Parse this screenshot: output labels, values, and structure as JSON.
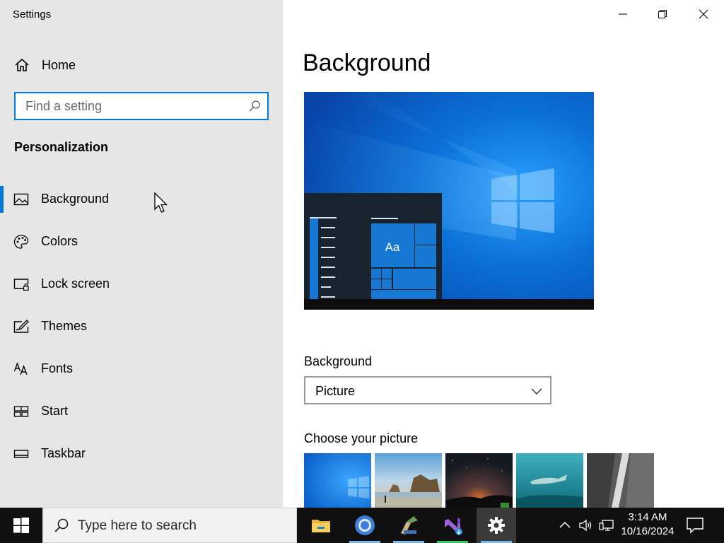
{
  "window": {
    "title": "Settings",
    "minimize_icon": "minimize-icon",
    "restore_icon": "restore-icon",
    "close_icon": "close-icon"
  },
  "sidebar": {
    "home_label": "Home",
    "search": {
      "placeholder": "Find a setting"
    },
    "section_title": "Personalization",
    "items": [
      {
        "label": "Background",
        "icon": "picture-icon",
        "selected": true
      },
      {
        "label": "Colors",
        "icon": "palette-icon",
        "selected": false
      },
      {
        "label": "Lock screen",
        "icon": "lock-screen-icon",
        "selected": false
      },
      {
        "label": "Themes",
        "icon": "themes-icon",
        "selected": false
      },
      {
        "label": "Fonts",
        "icon": "fonts-icon",
        "selected": false
      },
      {
        "label": "Start",
        "icon": "start-icon",
        "selected": false
      },
      {
        "label": "Taskbar",
        "icon": "taskbar-icon",
        "selected": false
      }
    ]
  },
  "main": {
    "title": "Background",
    "preview": {
      "tile_text": "Aa"
    },
    "background_label": "Background",
    "background_dropdown": {
      "selected": "Picture"
    },
    "choose_picture_label": "Choose your picture"
  },
  "taskbar": {
    "search_placeholder": "Type here to search",
    "apps": [
      "file-explorer-icon",
      "chrome-icon",
      "app-icon",
      "visual-studio-icon",
      "settings-gear-icon"
    ],
    "clock": {
      "time": "3:14 AM",
      "date": "10/16/2024"
    }
  },
  "colors": {
    "accent": "#0078d7",
    "sidebar_bg": "#e6e6e6",
    "taskbar_bg": "#101010"
  }
}
